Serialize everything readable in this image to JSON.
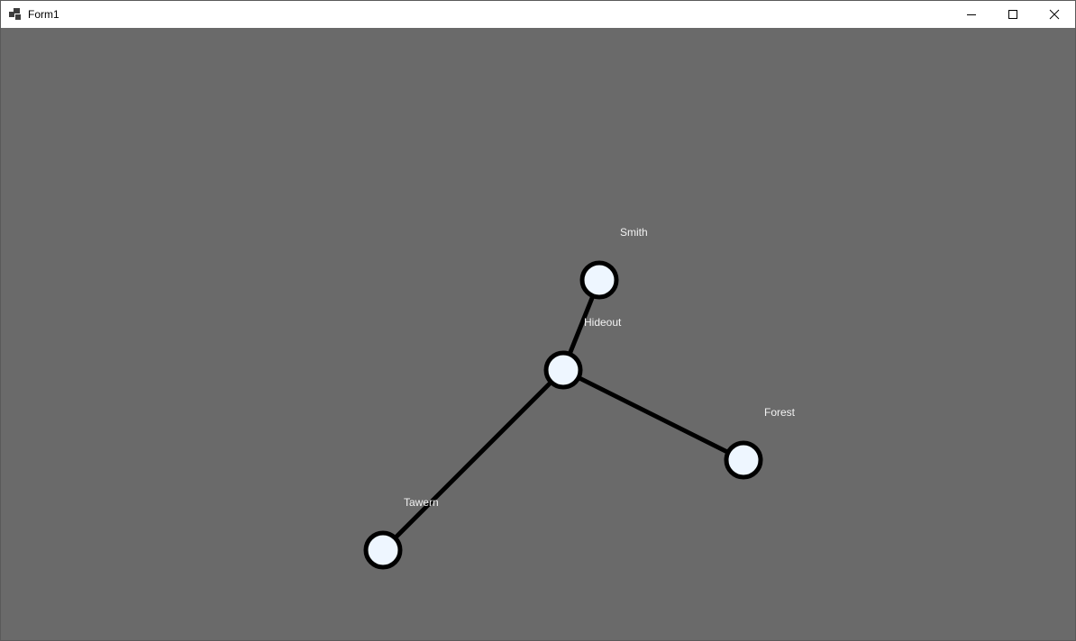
{
  "window": {
    "title": "Form1",
    "icon": "form-app-icon",
    "controls": {
      "minimize_icon": "minimize-icon",
      "maximize_icon": "maximize-icon",
      "close_icon": "close-icon"
    }
  },
  "graph": {
    "colors": {
      "background": "#6a6a6a",
      "node_fill": "#eef6ff",
      "node_stroke": "#000000",
      "edge": "#000000",
      "label": "#f2f2f2"
    },
    "nodes": [
      {
        "id": "smith",
        "label": "Smith"
      },
      {
        "id": "hideout",
        "label": "Hideout"
      },
      {
        "id": "forest",
        "label": "Forest"
      },
      {
        "id": "tawern",
        "label": "Tawern"
      }
    ],
    "edges": [
      {
        "from": "hideout",
        "to": "smith"
      },
      {
        "from": "hideout",
        "to": "forest"
      },
      {
        "from": "hideout",
        "to": "tawern"
      }
    ]
  }
}
